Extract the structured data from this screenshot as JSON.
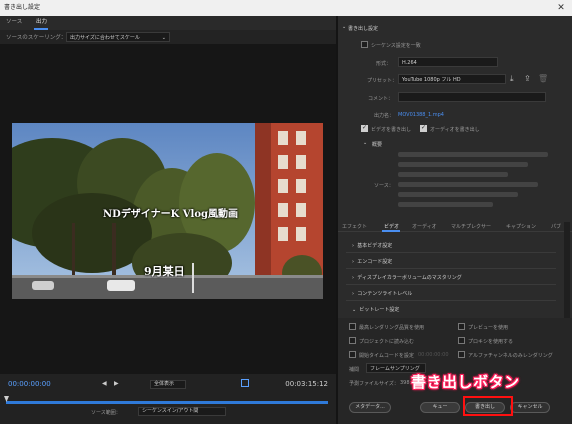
{
  "window": {
    "title": "書き出し設定",
    "close_glyph": "✕"
  },
  "left": {
    "tabs": [
      {
        "label": "ソース"
      },
      {
        "label": "出力"
      }
    ],
    "scaling_label": "ソースのスケーリング：",
    "scaling_value": "出力サイズに合わせてスケール",
    "overlay_title": "NDデザイナーK Vlog風動画",
    "overlay_date": "9月某日",
    "timecode_in": "00:00:00:00",
    "timecode_out": "00:03:15:12",
    "fit_value": "全体表示",
    "source_range_label": "ソース範囲：",
    "source_range_value": "シーケンスイン/アウト間"
  },
  "right": {
    "export_settings_header": "書き出し設定",
    "match_sequence_label": "シーケンス設定を一致",
    "format_label": "形式：",
    "format_value": "H.264",
    "preset_label": "プリセット：",
    "preset_value": "YouTube 1080p フル HD",
    "comment_label": "コメント：",
    "output_name_label": "出力名：",
    "output_name_value": "MOV01388_1.mp4",
    "export_video_label": "ビデオを書き出し",
    "export_audio_label": "オーディオを書き出し",
    "summary_header": "概要",
    "source_label": "ソース：",
    "tabs": [
      {
        "label": "エフェクト"
      },
      {
        "label": "ビデオ"
      },
      {
        "label": "オーディオ"
      },
      {
        "label": "マルチプレクサー"
      },
      {
        "label": "キャプション"
      },
      {
        "label": "パブ"
      }
    ],
    "sections": [
      {
        "label": "基本ビデオ設定"
      },
      {
        "label": "エンコード設定"
      },
      {
        "label": "ディスプレイカラーボリュームのマスタリング"
      },
      {
        "label": "コンテンツライトレベル"
      },
      {
        "label": "ビットレート設定"
      }
    ],
    "checkboxes": [
      {
        "label": "最高レンダリング品質を使用"
      },
      {
        "label": "プレビューを使用"
      },
      {
        "label": "プロジェクトに読み込む"
      },
      {
        "label": "プロキシを使用する"
      },
      {
        "label": "開始タイムコードを設定"
      },
      {
        "label": "アルファチャンネルのみレンダリング"
      }
    ],
    "start_tc_value": "00:00:00:00",
    "interp_label": "補間",
    "interp_value": "フレームサンプリング",
    "file_size_label": "予測ファイルサイズ：",
    "file_size_value": "398 MB",
    "buttons": {
      "metadata": "メタデータ...",
      "queue": "キュー",
      "export": "書き出し",
      "cancel": "キャンセル"
    }
  },
  "annotation": {
    "callout": "書き出しボタン",
    "box_color": "#ff1010",
    "glow_color": "#ff1f5a"
  },
  "colors": {
    "accent": "#4a8ef0",
    "timecode": "#2f7ad9"
  }
}
